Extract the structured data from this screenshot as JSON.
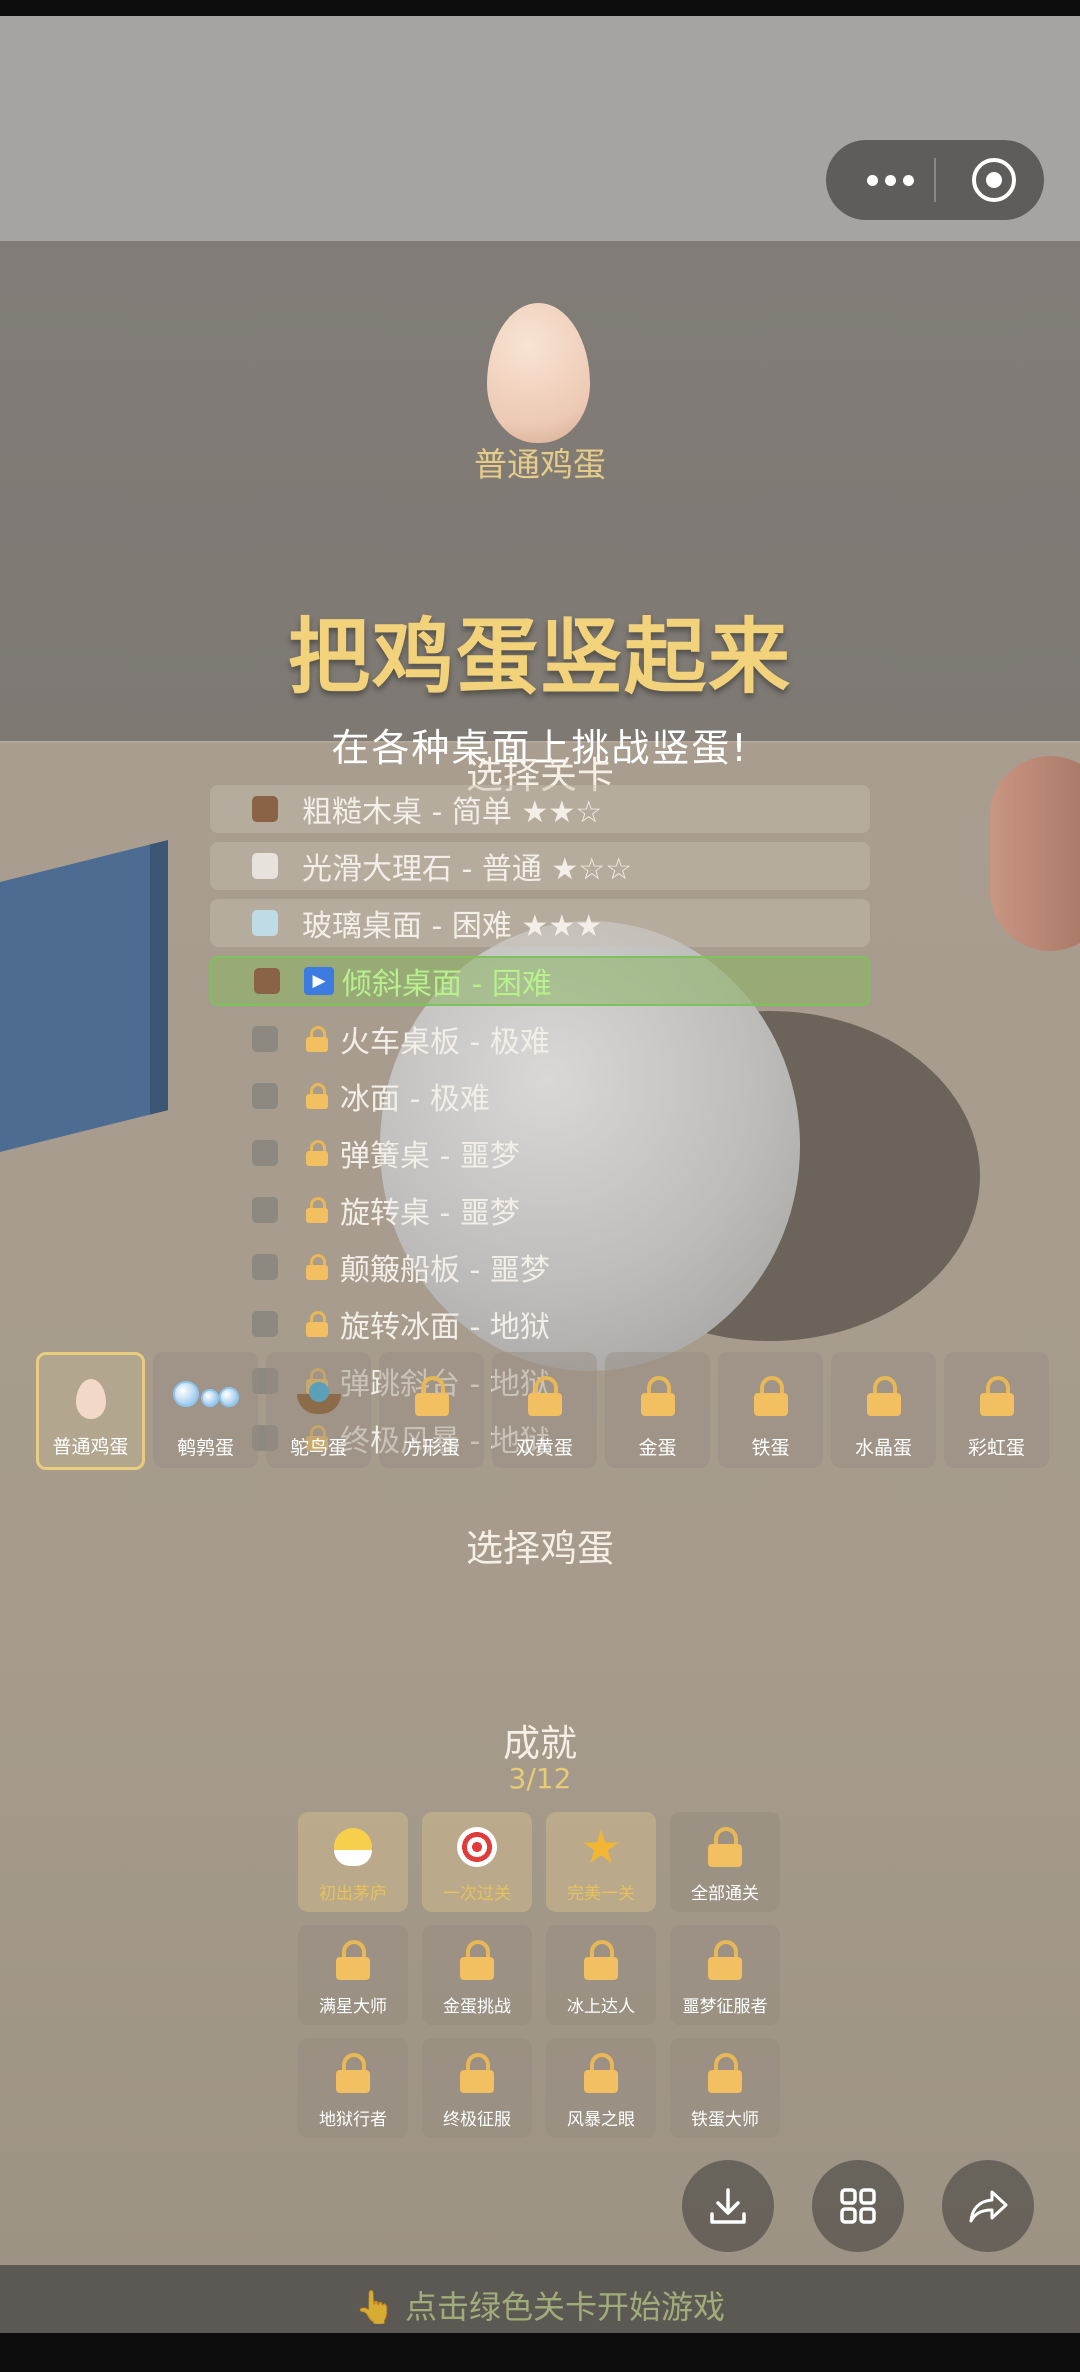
{
  "header": {
    "more_icon": "more-dots-icon",
    "close_icon": "record-target-icon"
  },
  "current_egg": {
    "name": "普通鸡蛋"
  },
  "title": "把鸡蛋竖起来",
  "subtitle": "在各种桌面上挑战竖蛋!",
  "level_section_title": "选择关卡",
  "levels": [
    {
      "label": "粗糙木桌 - 简单 ★★☆",
      "swatch": "#8a6245",
      "state": "open"
    },
    {
      "label": "光滑大理石 - 普通 ★☆☆",
      "swatch": "#e8e2dc",
      "state": "open"
    },
    {
      "label": "玻璃桌面 - 困难 ★★★",
      "swatch": "#bfdce6",
      "state": "open"
    },
    {
      "label": "倾斜桌面 - 困难",
      "swatch": "#8a6245",
      "state": "active"
    },
    {
      "label": "火车桌板 - 极难",
      "swatch": "#8e8980",
      "state": "locked"
    },
    {
      "label": "冰面 - 极难",
      "swatch": "#8e8980",
      "state": "locked"
    },
    {
      "label": "弹簧桌 - 噩梦",
      "swatch": "#8e8980",
      "state": "locked"
    },
    {
      "label": "旋转桌 - 噩梦",
      "swatch": "#8e8980",
      "state": "locked"
    },
    {
      "label": "颠簸船板 - 噩梦",
      "swatch": "#8e8980",
      "state": "locked"
    },
    {
      "label": "旋转冰面 - 地狱",
      "swatch": "#8e8980",
      "state": "locked"
    },
    {
      "label": "弹跳斜台 - 地狱",
      "swatch": "#8e8980",
      "state": "locked"
    },
    {
      "label": "终极风暴 - 地狱",
      "swatch": "#8e8980",
      "state": "locked"
    }
  ],
  "egg_section_title": "选择鸡蛋",
  "eggs": [
    {
      "label": "普通鸡蛋",
      "icon": "egg-icon",
      "selected": true
    },
    {
      "label": "鹌鹑蛋",
      "icon": "bubbles-icon"
    },
    {
      "label": "鸵鸟蛋",
      "icon": "nest-icon"
    },
    {
      "label": "方形蛋",
      "icon": "lock-icon"
    },
    {
      "label": "双黄蛋",
      "icon": "lock-icon"
    },
    {
      "label": "金蛋",
      "icon": "lock-icon"
    },
    {
      "label": "铁蛋",
      "icon": "lock-icon"
    },
    {
      "label": "水晶蛋",
      "icon": "lock-icon"
    },
    {
      "label": "彩虹蛋",
      "icon": "lock-icon"
    }
  ],
  "achievements_title": "成就",
  "achievements_count": "3/12",
  "achievements": [
    {
      "label": "初出茅庐",
      "icon": "chick-icon",
      "done": true
    },
    {
      "label": "一次过关",
      "icon": "target-icon",
      "done": true
    },
    {
      "label": "完美一关",
      "icon": "star-icon",
      "done": true
    },
    {
      "label": "全部通关",
      "icon": "lock-icon"
    },
    {
      "label": "满星大师",
      "icon": "lock-icon"
    },
    {
      "label": "金蛋挑战",
      "icon": "lock-icon"
    },
    {
      "label": "冰上达人",
      "icon": "lock-icon"
    },
    {
      "label": "噩梦征服者",
      "icon": "lock-icon"
    },
    {
      "label": "地狱行者",
      "icon": "lock-icon"
    },
    {
      "label": "终极征服",
      "icon": "lock-icon"
    },
    {
      "label": "风暴之眼",
      "icon": "lock-icon"
    },
    {
      "label": "铁蛋大师",
      "icon": "lock-icon"
    }
  ],
  "fabs": {
    "download": "download-icon",
    "grid": "grid-icon",
    "share": "share-icon"
  },
  "hint": "👆 点击绿色关卡开始游戏",
  "colors": {
    "accent_gold": "#f2d27a",
    "active_green": "#7cc35a"
  }
}
